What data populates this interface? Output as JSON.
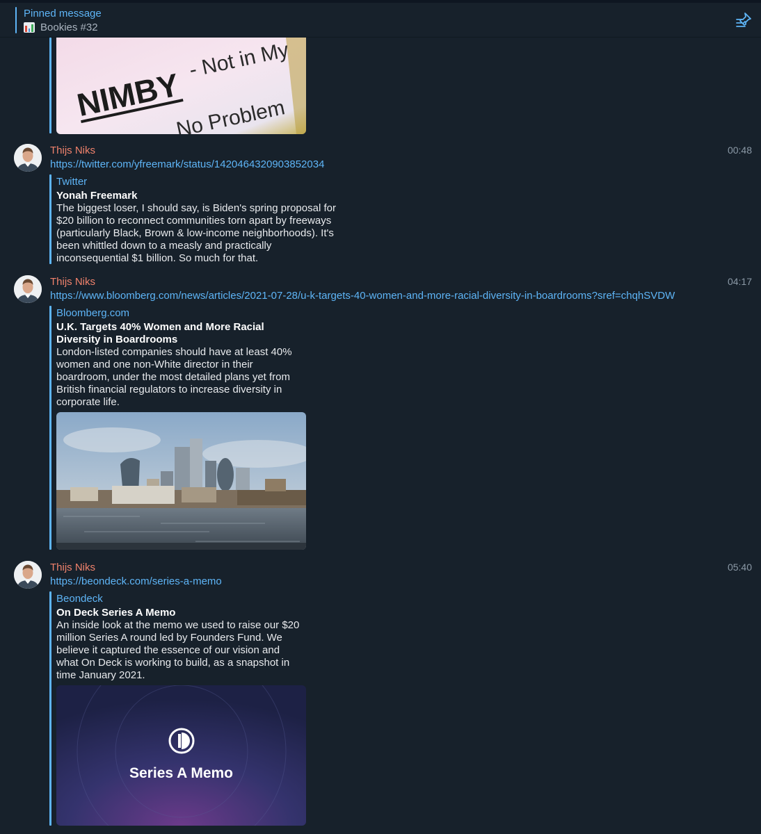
{
  "pinned": {
    "title": "Pinned message",
    "text": "Bookies #32",
    "icon": "bar-chart-icon"
  },
  "previous_image": {
    "text_big": "NIMBY",
    "text_small": "- Not in My",
    "text_bottom": "No Problem"
  },
  "messages": [
    {
      "sender": "Thijs Niks",
      "time": "00:48",
      "link": "https://twitter.com/yfreemark/status/1420464320903852034",
      "site": "Twitter",
      "title": "Yonah Freemark",
      "description": "The biggest loser, I should say, is Biden's spring proposal for\n$20 billion to reconnect communities torn apart by freeways\n(particularly Black, Brown & low-income neighborhoods). It's\nbeen whittled down to a measly and practically\ninconsequential $1 billion. So much for that."
    },
    {
      "sender": "Thijs Niks",
      "time": "04:17",
      "link": "https://www.bloomberg.com/news/articles/2021-07-28/u-k-targets-40-women-and-more-racial-diversity-in-boardrooms?sref=chqhSVDW",
      "site": "Bloomberg.com",
      "title": "U.K. Targets 40% Women and More Racial\nDiversity in Boardrooms",
      "description": "London-listed companies should have at least 40%\nwomen and one non-White director in their\nboardroom, under the most detailed plans yet from\nBritish financial regulators to increase diversity in\ncorporate life."
    },
    {
      "sender": "Thijs Niks",
      "time": "05:40",
      "link": "https://beondeck.com/series-a-memo",
      "site": "Beondeck",
      "title": "On Deck Series A Memo",
      "description": "An inside look at the memo we used to raise our $20\nmillion Series A round led by Founders Fund. We\nbelieve it captured the essence of our vision and\nwhat On Deck is working to build, as a snapshot in\ntime January 2021.",
      "image_text": "Series A Memo"
    }
  ],
  "colors": {
    "background": "#17212b",
    "accent": "#5eb5f7",
    "sender": "#f0826c"
  }
}
